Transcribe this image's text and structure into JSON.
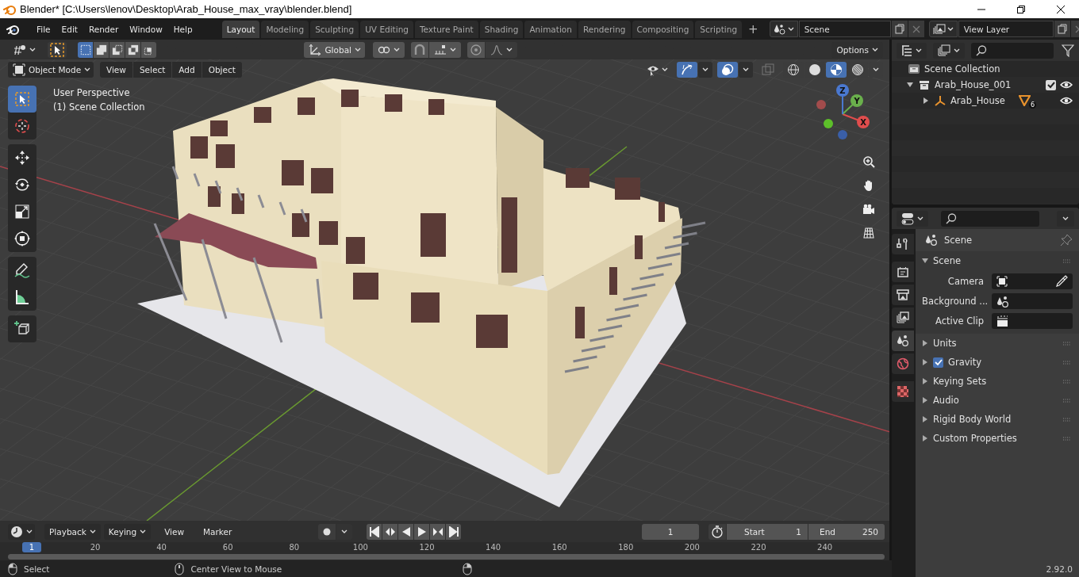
{
  "window": {
    "title": "Blender* [C:\\Users\\lenov\\Desktop\\Arab_House_max_vray\\blender.blend]"
  },
  "menus": [
    "File",
    "Edit",
    "Render",
    "Window",
    "Help"
  ],
  "workspaces": [
    {
      "label": "Layout",
      "selected": true
    },
    {
      "label": "Modeling",
      "selected": false
    },
    {
      "label": "Sculpting",
      "selected": false
    },
    {
      "label": "UV Editing",
      "selected": false
    },
    {
      "label": "Texture Paint",
      "selected": false
    },
    {
      "label": "Shading",
      "selected": false
    },
    {
      "label": "Animation",
      "selected": false
    },
    {
      "label": "Rendering",
      "selected": false
    },
    {
      "label": "Compositing",
      "selected": false
    },
    {
      "label": "Scripting",
      "selected": false
    }
  ],
  "add_workspace": "+",
  "scene_selector": {
    "value": "Scene"
  },
  "view_layer_selector": {
    "value": "View Layer"
  },
  "tool_settings": {
    "orientation": "Global",
    "options": "Options",
    "select_modes": [
      {
        "kind": "set",
        "selected": true
      },
      {
        "kind": "extend",
        "selected": false
      },
      {
        "kind": "subtract",
        "selected": false
      },
      {
        "kind": "difference",
        "selected": false
      },
      {
        "kind": "intersect",
        "selected": false
      }
    ],
    "snap_on": false,
    "proportional_on": false
  },
  "viewport_header": {
    "mode": "Object Mode",
    "menus": [
      "View",
      "Select",
      "Add",
      "Object"
    ],
    "gizmos_on": true,
    "overlays_on": true,
    "xray_on": false,
    "shading": [
      {
        "kind": "wireframe",
        "selected": false
      },
      {
        "kind": "solid",
        "selected": false
      },
      {
        "kind": "material",
        "selected": true
      },
      {
        "kind": "rendered",
        "selected": false
      }
    ]
  },
  "viewport": {
    "info": [
      "User Perspective",
      "(1) Scene Collection"
    ],
    "axes": [
      "X",
      "Y",
      "Z"
    ],
    "tools": [
      {
        "kind": "select",
        "selected": true
      },
      {
        "kind": "cursor",
        "selected": false
      },
      {
        "kind": "move",
        "selected": false
      },
      {
        "kind": "rotate",
        "selected": false
      },
      {
        "kind": "scale",
        "selected": false
      },
      {
        "kind": "transform",
        "selected": false
      },
      {
        "kind": "annotate",
        "selected": false
      },
      {
        "kind": "measure",
        "selected": false
      },
      {
        "kind": "add-cube",
        "selected": false
      }
    ]
  },
  "outliner": {
    "tree": [
      {
        "label": "Scene Collection",
        "kind": "scene-collection",
        "children": [
          {
            "label": "Arab_House_001",
            "kind": "collection",
            "expanded": true,
            "checked": true,
            "visible": true,
            "children": [
              {
                "label": "Arab_House",
                "kind": "empty",
                "expanded": false,
                "visible": true,
                "badge": "6"
              }
            ]
          }
        ]
      }
    ]
  },
  "properties": {
    "tabs": [
      {
        "kind": "tool",
        "selected": false
      },
      {
        "kind": "render",
        "selected": false
      },
      {
        "kind": "output",
        "selected": false
      },
      {
        "kind": "view-layer",
        "selected": false
      },
      {
        "kind": "scene",
        "selected": true
      },
      {
        "kind": "world",
        "selected": false
      },
      {
        "kind": "texture",
        "selected": false
      }
    ],
    "context": "Scene",
    "panels": [
      {
        "label": "Scene",
        "expanded": true,
        "fields": [
          {
            "label": "Camera",
            "kind": "camera"
          },
          {
            "label": "Background ...",
            "kind": "scene"
          },
          {
            "label": "Active Clip",
            "kind": "clip"
          }
        ]
      },
      {
        "label": "Units",
        "expanded": false
      },
      {
        "label": "Gravity",
        "expanded": false,
        "checked": true
      },
      {
        "label": "Keying Sets",
        "expanded": false
      },
      {
        "label": "Audio",
        "expanded": false
      },
      {
        "label": "Rigid Body World",
        "expanded": false
      },
      {
        "label": "Custom Properties",
        "expanded": false
      }
    ]
  },
  "timeline": {
    "menus": [
      {
        "label": "Playback",
        "dropdown": true
      },
      {
        "label": "Keying",
        "dropdown": true
      },
      {
        "label": "View",
        "dropdown": false
      },
      {
        "label": "Marker",
        "dropdown": false
      }
    ],
    "current_frame": "1",
    "start_label": "Start",
    "start": "1",
    "end_label": "End",
    "end": "250",
    "playhead": "1",
    "ticks": [
      "20",
      "40",
      "60",
      "80",
      "100",
      "120",
      "140",
      "160",
      "180",
      "200",
      "220",
      "240"
    ]
  },
  "status_bar": {
    "actions": [
      {
        "kind": "left-click",
        "label": "Select"
      },
      {
        "kind": "middle-click",
        "label": "Center View to Mouse"
      },
      {
        "kind": "right-click"
      }
    ],
    "version": "2.92.0"
  }
}
